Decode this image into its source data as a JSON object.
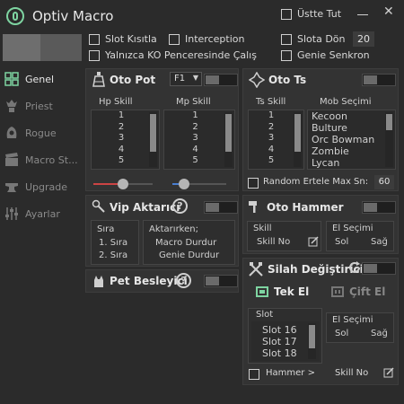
{
  "window": {
    "title": "Optiv Macro",
    "topmost_label": "Üstte Tut",
    "minimize": "—",
    "close": "✕"
  },
  "options": {
    "slot_limit": "Slot Kısıtla",
    "interception": "Interception",
    "slot_return": "Slota Dön",
    "slot_return_value": "20",
    "ko_window_only": "Yalnızca KO Penceresinde Çalış",
    "genie_sync": "Genie Senkron"
  },
  "sidebar": {
    "items": [
      {
        "label": "Genel",
        "icon": "grid-icon"
      },
      {
        "label": "Priest",
        "icon": "priest-icon"
      },
      {
        "label": "Rogue",
        "icon": "rogue-icon"
      },
      {
        "label": "Macro St...",
        "icon": "clapper-icon"
      },
      {
        "label": "Upgrade",
        "icon": "anvil-icon"
      },
      {
        "label": "Ayarlar",
        "icon": "sliders-icon"
      }
    ]
  },
  "oto_pot": {
    "title": "Oto Pot",
    "key": "F1",
    "hp_label": "Hp Skill",
    "mp_label": "Mp Skill",
    "hp_items": [
      "1",
      "2",
      "3",
      "4",
      "5"
    ],
    "mp_items": [
      "1",
      "2",
      "3",
      "4",
      "5"
    ],
    "hp_slider_fraction": 0.5,
    "mp_slider_fraction": 0.15
  },
  "oto_ts": {
    "title": "Oto Ts",
    "ts_label": "Ts Skill",
    "mob_label": "Mob Seçimi",
    "ts_items": [
      "1",
      "2",
      "3",
      "4",
      "5"
    ],
    "mob_items": [
      "Kecoon",
      "Bulture",
      "Orc Bowman",
      "Zombie",
      "Lycan"
    ],
    "random_label": "Random Ertele Max Sn:",
    "random_value": "60"
  },
  "vip": {
    "title": "Vip Aktarıcı",
    "order_label": "Sıra",
    "order_items": [
      "1. Sıra",
      "2. Sıra"
    ],
    "transfer_label": "Aktarırken;",
    "transfer_items": [
      "Macro Durdur",
      "Genie Durdur"
    ]
  },
  "pet": {
    "title": "Pet Besleyici"
  },
  "hammer": {
    "title": "Oto Hammer",
    "skill_label": "Skill",
    "skill_value": "Skill No",
    "el_label": "El Seçimi",
    "left": "Sol",
    "right": "Sağ"
  },
  "silah": {
    "title": "Silah Değiştirici",
    "single_hand": "Tek El",
    "dual_hand": "Çift El",
    "slot_label": "Slot",
    "slot_items": [
      "Slot 16",
      "Slot 17",
      "Slot 18"
    ],
    "el_label": "El Seçimi",
    "left": "Sol",
    "right": "Sağ",
    "hammer_label": "Hammer >",
    "skill_no": "Skill No"
  }
}
